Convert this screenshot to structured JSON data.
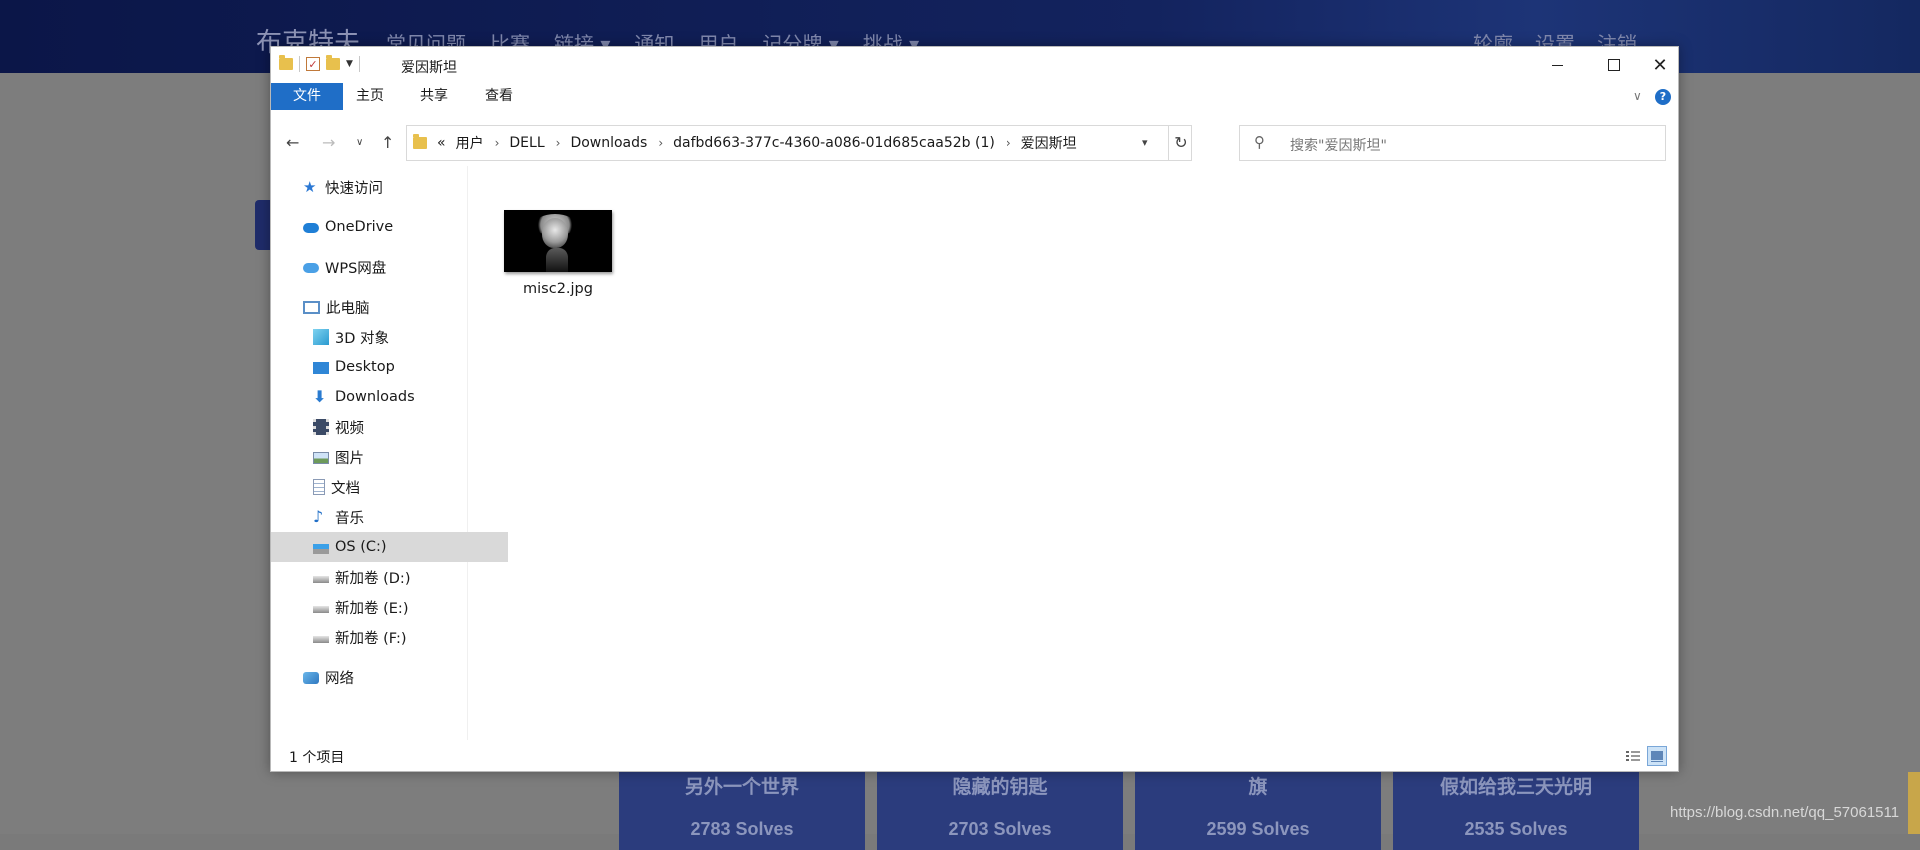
{
  "background_site": {
    "brand": "布克特夫",
    "nav_links": [
      "常见问题",
      "比赛",
      "链接 ▾",
      "通知",
      "用户",
      "记分牌 ▾",
      "挑战 ▾"
    ],
    "nav_right": [
      "轮廓",
      "设置",
      "注销"
    ],
    "cards": [
      {
        "title": "另外一个世界",
        "solves": "2783 Solves"
      },
      {
        "title": "隐藏的钥匙",
        "solves": "2703 Solves"
      },
      {
        "title": "旗",
        "solves": "2599 Solves"
      },
      {
        "title": "假如给我三天光明",
        "solves": "2535 Solves"
      }
    ],
    "watermark": "https://blog.csdn.net/qq_57061511"
  },
  "window": {
    "title": "爱因斯坦",
    "controls": {
      "minimize": "minimize",
      "maximize": "maximize",
      "close": "✕"
    },
    "ribbon_tabs": {
      "file": "文件",
      "home": "主页",
      "share": "共享",
      "view": "查看"
    },
    "help": "?",
    "address": {
      "overflow": "«",
      "crumbs": [
        "用户",
        "DELL",
        "Downloads",
        "dafbd663-377c-4360-a086-01d685caa52b (1)",
        "爱因斯坦"
      ]
    },
    "search_placeholder": "搜索\"爱因斯坦\"",
    "sidebar": {
      "quick_access": "快速访问",
      "onedrive": "OneDrive",
      "wps": "WPS网盘",
      "this_pc": "此电脑",
      "objects3d": "3D 对象",
      "desktop": "Desktop",
      "downloads": "Downloads",
      "videos": "视频",
      "pictures": "图片",
      "documents": "文档",
      "music": "音乐",
      "os_c": "OS (C:)",
      "vol_d": "新加卷 (D:)",
      "vol_e": "新加卷 (E:)",
      "vol_f": "新加卷 (F:)",
      "network": "网络"
    },
    "files": [
      {
        "name": "misc2.jpg"
      }
    ],
    "status": {
      "item_count": "1 个项目"
    }
  }
}
